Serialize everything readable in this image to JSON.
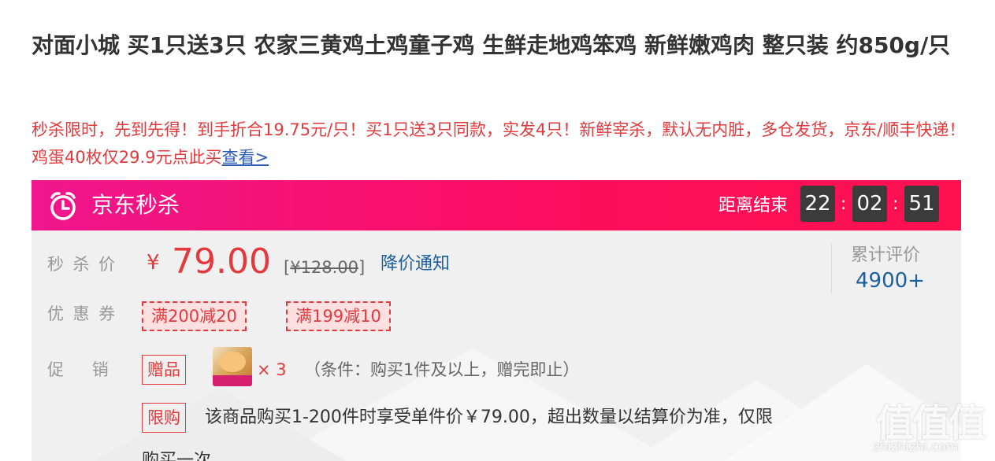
{
  "product": {
    "title": "对面小城 买1只送3只 农家三黄鸡土鸡童子鸡 生鲜走地鸡笨鸡 新鲜嫩鸡肉 整只装 约850g/只",
    "promo_text": "秒杀限时，先到先得！到手折合19.75元/只！买1只送3只同款，实发4只！新鲜宰杀，默认无内脏，多仓发货，京东/顺丰快递！鸡蛋40枚仅29.9元点此买",
    "promo_link": "查看>"
  },
  "seckill": {
    "title": "京东秒杀",
    "ends_label": "距离结束",
    "countdown": [
      "22",
      "02",
      "51"
    ],
    "separator": ":",
    "gradient_start": "#f0168c",
    "gradient_end": "#ff1150"
  },
  "price": {
    "label": "秒杀价",
    "currency": "¥",
    "value": "79.00",
    "original_open": "[",
    "original": "¥128.00",
    "original_close": "]",
    "notify_link": "降价通知",
    "color": "#e4393c"
  },
  "reviews": {
    "label": "累计评价",
    "count": "4900+"
  },
  "coupons": {
    "label": "优惠券",
    "items": [
      "满200减20",
      "满199减10"
    ]
  },
  "promotion": {
    "label": "促销",
    "gift_tag": "赠品",
    "gift_qty": "× 3",
    "gift_condition": "（条件：购买1件及以上，赠完即止）",
    "limit_tag": "限购",
    "limit_text": "该商品购买1-200件时享受单件价￥79.00，超出数量以结算价为准，仅限",
    "limit_text_cont": "购买一次"
  },
  "watermark": {
    "logo": "值值值",
    "url": "zhizhizhi.com"
  }
}
